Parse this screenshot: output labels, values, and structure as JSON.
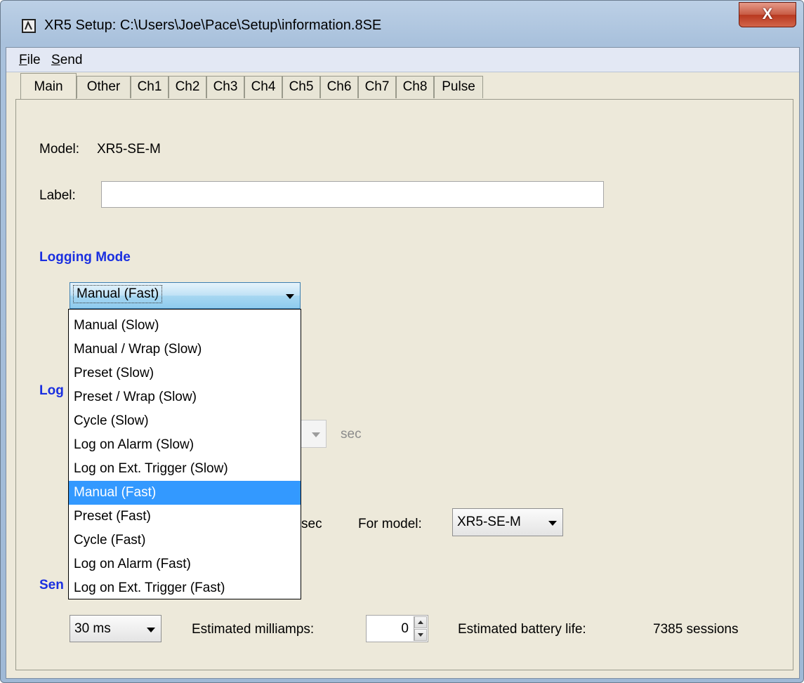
{
  "window": {
    "title": "XR5 Setup: C:\\Users\\Joe\\Pace\\Setup\\information.8SE",
    "close_label": "X"
  },
  "menu": [
    {
      "label": "File",
      "mnemonic": "F",
      "rest": "ile"
    },
    {
      "label": "Send",
      "mnemonic": "S",
      "rest": "end"
    }
  ],
  "tabs": [
    "Main",
    "Other",
    "Ch1",
    "Ch2",
    "Ch3",
    "Ch4",
    "Ch5",
    "Ch6",
    "Ch7",
    "Ch8",
    "Pulse"
  ],
  "active_tab": "Main",
  "main": {
    "model_label": "Model:",
    "model_value": "XR5-SE-M",
    "label_label": "Label:",
    "label_value": "",
    "logging_mode_title": "Logging Mode",
    "logging_mode_selected": "Manual (Fast)",
    "logging_mode_options": [
      "Manual (Slow)",
      "Manual / Wrap (Slow)",
      "Preset (Slow)",
      "Preset / Wrap (Slow)",
      "Cycle (Slow)",
      "Log on Alarm (Slow)",
      "Log on Ext. Trigger (Slow)",
      "Manual (Fast)",
      "Preset (Fast)",
      "Cycle (Fast)",
      "Log on Alarm (Fast)",
      "Log on Ext. Trigger (Fast)"
    ],
    "section2_title_partial": "Log",
    "interval_unit": "sec",
    "fast_unit_partial": "sec",
    "for_model_label": "For model:",
    "for_model_value": "XR5-SE-M",
    "section3_title_partial": "Sen",
    "sensor_time_value": "30 ms",
    "milliamps_label": "Estimated milliamps:",
    "milliamps_value": "0",
    "battery_label": "Estimated battery life:",
    "battery_value": "7385 sessions"
  },
  "colors": {
    "section_title": "#1a2fe0",
    "dialog_bg": "#ede9da",
    "selection": "#3399ff"
  }
}
